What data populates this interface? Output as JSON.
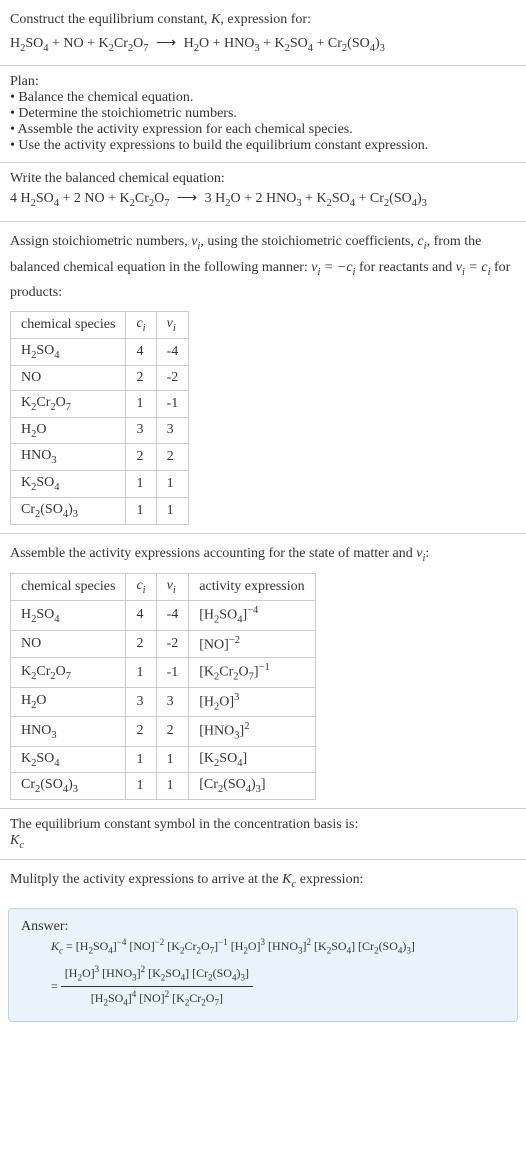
{
  "sec1": {
    "title_a": "Construct the equilibrium constant, ",
    "title_b": ", expression for:"
  },
  "sec2": {
    "heading": "Plan:",
    "b1": "• Balance the chemical equation.",
    "b2": "• Determine the stoichiometric numbers.",
    "b3": "• Assemble the activity expression for each chemical species.",
    "b4": "• Use the activity expressions to build the equilibrium constant expression."
  },
  "sec3": {
    "heading": "Write the balanced chemical equation:"
  },
  "sec4": {
    "t1": "Assign stoichiometric numbers, ",
    "t2": ", using the stoichiometric coefficients, ",
    "t3": ", from the balanced chemical equation in the following manner: ",
    "t4": " for reactants and ",
    "t5": " for products:"
  },
  "table1": {
    "h1": "chemical species",
    "rows": [
      {
        "sp": "H2SO4",
        "c": "4",
        "v": "-4"
      },
      {
        "sp": "NO",
        "c": "2",
        "v": "-2"
      },
      {
        "sp": "K2Cr2O7",
        "c": "1",
        "v": "-1"
      },
      {
        "sp": "H2O",
        "c": "3",
        "v": "3"
      },
      {
        "sp": "HNO3",
        "c": "2",
        "v": "2"
      },
      {
        "sp": "K2SO4",
        "c": "1",
        "v": "1"
      },
      {
        "sp": "Cr2(SO4)3",
        "c": "1",
        "v": "1"
      }
    ]
  },
  "sec5": {
    "t1": "Assemble the activity expressions accounting for the state of matter and "
  },
  "table2": {
    "h1": "chemical species",
    "h4": "activity expression"
  },
  "sec6": {
    "t1": "The equilibrium constant symbol in the concentration basis is:"
  },
  "sec7": {
    "t1": "Mulitply the activity expressions to arrive at the ",
    "t2": " expression:"
  },
  "answer": {
    "label": "Answer:"
  },
  "chart_data": {
    "type": "table",
    "title": "Stoichiometric and activity tables for K expression",
    "reaction_unbalanced": "H2SO4 + NO + K2Cr2O7 -> H2O + HNO3 + K2SO4 + Cr2(SO4)3",
    "reaction_balanced": "4 H2SO4 + 2 NO + K2Cr2O7 -> 3 H2O + 2 HNO3 + K2SO4 + Cr2(SO4)3",
    "stoich_table": {
      "columns": [
        "chemical species",
        "c_i",
        "v_i"
      ],
      "rows": [
        [
          "H2SO4",
          4,
          -4
        ],
        [
          "NO",
          2,
          -2
        ],
        [
          "K2Cr2O7",
          1,
          -1
        ],
        [
          "H2O",
          3,
          3
        ],
        [
          "HNO3",
          2,
          2
        ],
        [
          "K2SO4",
          1,
          1
        ],
        [
          "Cr2(SO4)3",
          1,
          1
        ]
      ]
    },
    "activity_table": {
      "columns": [
        "chemical species",
        "c_i",
        "v_i",
        "activity expression"
      ],
      "rows": [
        [
          "H2SO4",
          4,
          -4,
          "[H2SO4]^-4"
        ],
        [
          "NO",
          2,
          -2,
          "[NO]^-2"
        ],
        [
          "K2Cr2O7",
          1,
          -1,
          "[K2Cr2O7]^-1"
        ],
        [
          "H2O",
          3,
          3,
          "[H2O]^3"
        ],
        [
          "HNO3",
          2,
          2,
          "[HNO3]^2"
        ],
        [
          "K2SO4",
          1,
          1,
          "[K2SO4]"
        ],
        [
          "Cr2(SO4)3",
          1,
          1,
          "[Cr2(SO4)3]"
        ]
      ]
    },
    "Kc_product": "[H2SO4]^-4 [NO]^-2 [K2Cr2O7]^-1 [H2O]^3 [HNO3]^2 [K2SO4] [Cr2(SO4)3]",
    "Kc_fraction": {
      "numerator": "[H2O]^3 [HNO3]^2 [K2SO4] [Cr2(SO4)3]",
      "denominator": "[H2SO4]^4 [NO]^2 [K2Cr2O7]"
    }
  }
}
